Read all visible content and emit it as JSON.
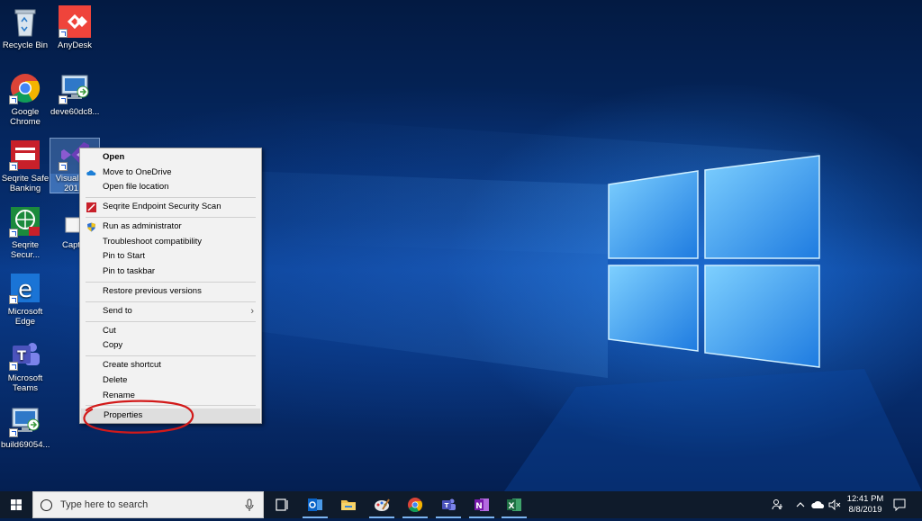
{
  "desktop": {
    "icons": [
      {
        "label": "Recycle Bin"
      },
      {
        "label": "AnyDesk"
      },
      {
        "label": "Google Chrome"
      },
      {
        "label": "deve60dc8..."
      },
      {
        "label": "Seqrite Safe Banking"
      },
      {
        "label": "Visual S... 201..."
      },
      {
        "label": "Seqrite Secur..."
      },
      {
        "label": "Capt..."
      },
      {
        "label": "Microsoft Edge"
      },
      {
        "label": "Microsoft Teams"
      },
      {
        "label": "build69054..."
      }
    ]
  },
  "context_menu": {
    "items": {
      "open": "Open",
      "move_onedrive": "Move to OneDrive",
      "open_location": "Open file location",
      "seqrite_scan": "Seqrite Endpoint Security Scan",
      "run_admin": "Run as administrator",
      "troubleshoot": "Troubleshoot compatibility",
      "pin_start": "Pin to Start",
      "pin_taskbar": "Pin to taskbar",
      "restore": "Restore previous versions",
      "send_to": "Send to",
      "cut": "Cut",
      "copy": "Copy",
      "create_shortcut": "Create shortcut",
      "delete": "Delete",
      "rename": "Rename",
      "properties": "Properties"
    },
    "highlighted": "Properties"
  },
  "taskbar": {
    "search_placeholder": "Type here to search",
    "apps": [
      "task-view",
      "outlook",
      "file-explorer",
      "paint",
      "chrome",
      "teams",
      "onenote",
      "excel"
    ],
    "clock_time": "12:41 PM",
    "clock_date": "8/8/2019"
  },
  "colors": {
    "highlight_circle": "#d21a1a",
    "taskbar": "#0f1b2b",
    "menu_bg": "#f2f2f2"
  }
}
